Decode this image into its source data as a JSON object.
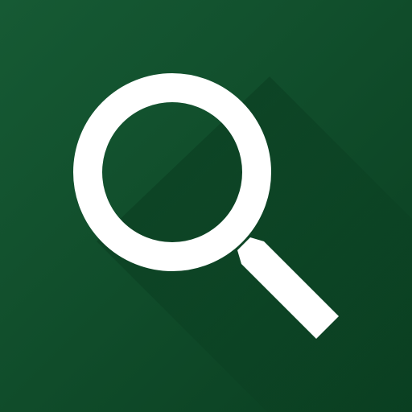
{
  "icon": {
    "name": "search-icon",
    "background_color": "#0f4d2a",
    "background_color_light": "#165a34",
    "background_color_dark": "#0a3f21",
    "foreground_color": "#ffffff",
    "shadow_color": "#07351b"
  }
}
